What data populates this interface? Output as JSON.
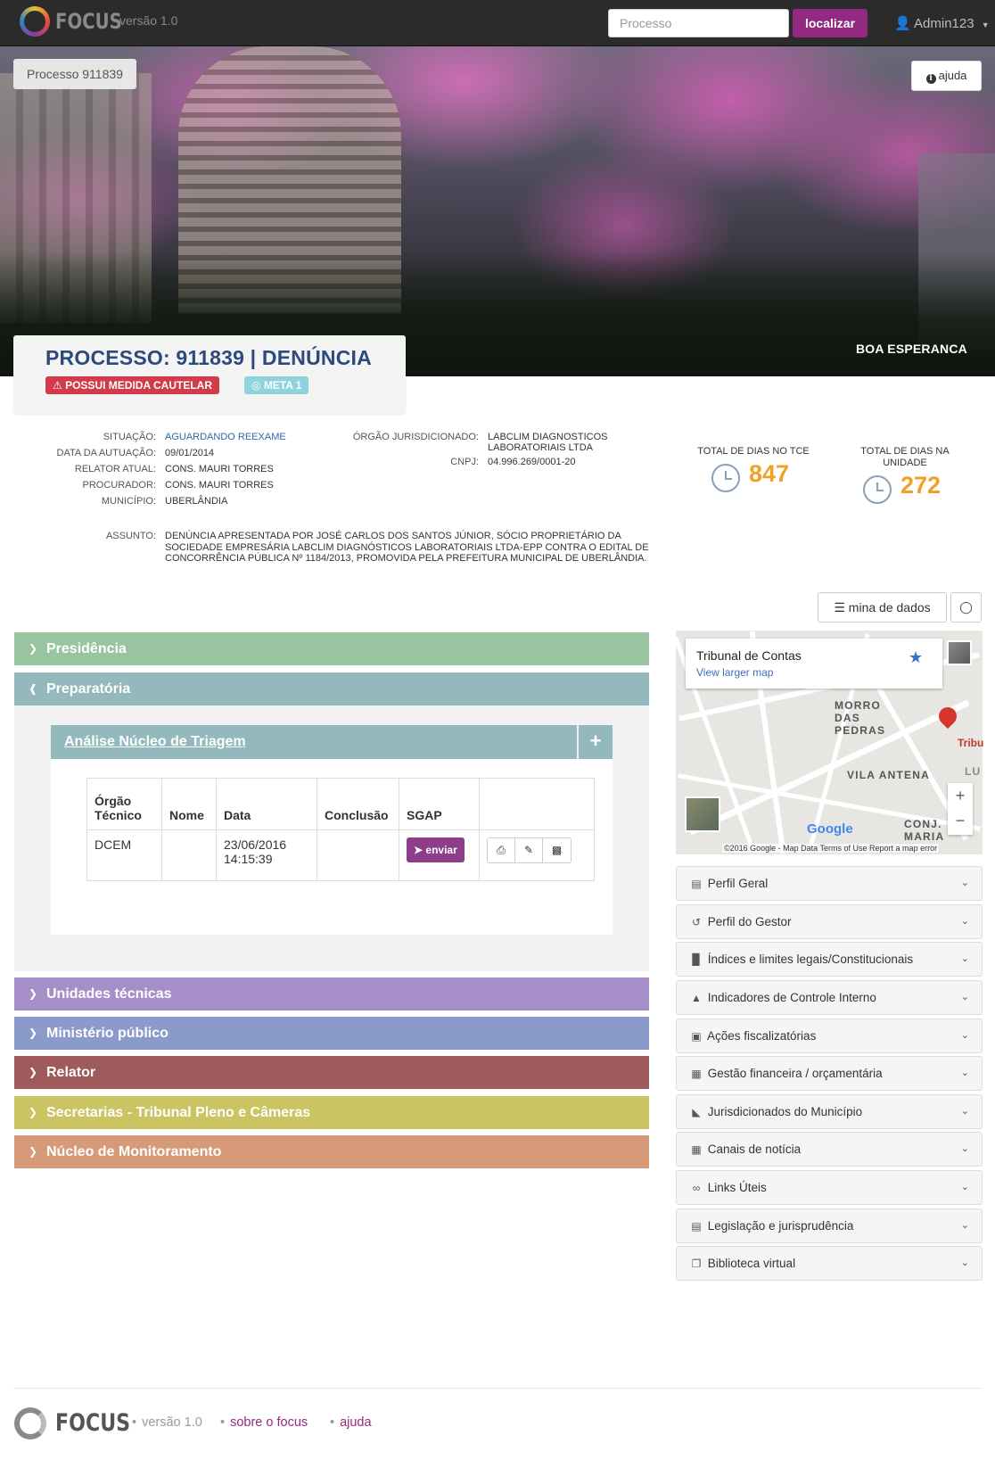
{
  "navbar": {
    "brand": "FOCUS",
    "version": "versão 1.0",
    "search_placeholder": "Processo",
    "search_button": "localizar",
    "user": "Admin123"
  },
  "hero": {
    "tag": "Processo 911839",
    "help": "ajuda",
    "city": "BOA ESPERANCA"
  },
  "title": {
    "heading": "PROCESSO: 911839 | DENÚNCIA",
    "badge_caution": "POSSUI MEDIDA CAUTELAR",
    "badge_meta": "META 1"
  },
  "info_left": [
    {
      "label": "SITUAÇÃO:",
      "value": "AGUARDANDO REEXAME"
    },
    {
      "label": "DATA DA AUTUAÇÃO:",
      "value": "09/01/2014"
    },
    {
      "label": "RELATOR ATUAL:",
      "value": "CONS. MAURI TORRES"
    },
    {
      "label": "PROCURADOR:",
      "value": "CONS. MAURI TORRES"
    },
    {
      "label": "MUNICÍPIO:",
      "value": "UBERLÂNDIA"
    }
  ],
  "info_right": [
    {
      "label": "ÓRGÃO JURISDICIONADO:",
      "value": "LABCLIM DIAGNOSTICOS LABORATORIAIS LTDA"
    },
    {
      "label": "CNPJ:",
      "value": "04.996.269/0001-20"
    }
  ],
  "subject": {
    "label": "ASSUNTO:",
    "text": "DENÚNCIA APRESENTADA POR JOSÉ CARLOS DOS SANTOS JÚNIOR, SÓCIO PROPRIETÁRIO DA SOCIEDADE EMPRESÁRIA LABCLIM DIAGNÓSTICOS LABORATORIAIS LTDA-EPP CONTRA O EDITAL DE CONCORRÊNCIA PÚBLICA Nº 1184/2013, PROMOVIDA PELA PREFEITURA MUNICIPAL DE UBERLÂNDIA."
  },
  "stats": {
    "tce_label": "TOTAL DE DIAS NO TCE",
    "tce_value": "847",
    "unit_label": "TOTAL DE DIAS NA UNIDADE",
    "unit_value": "272"
  },
  "toolbar": {
    "mine_label": "mina de dados"
  },
  "accordion": [
    {
      "label": "Presidência",
      "color": "#98c4a0",
      "open": false
    },
    {
      "label": "Preparatória",
      "color": "#94b9bc",
      "open": true
    },
    {
      "label": "Unidades técnicas",
      "color": "#a68fc9",
      "open": false
    },
    {
      "label": "Ministério público",
      "color": "#8a9bcb",
      "open": false
    },
    {
      "label": "Relator",
      "color": "#9f5b5b",
      "open": false
    },
    {
      "label": "Secretarias - Tribunal Pleno e Câmeras",
      "color": "#cac462",
      "open": false
    },
    {
      "label": "Núcleo de Monitoramento",
      "color": "#d79a78",
      "open": false
    }
  ],
  "sub_section": {
    "title": "Análise Núcleo de Triagem"
  },
  "table": {
    "headers": [
      "Órgão Técnico",
      "Nome",
      "Data",
      "Conclusão",
      "SGAP",
      ""
    ],
    "row": {
      "orgao": "DCEM",
      "nome": "",
      "data_date": "23/06/2016",
      "data_time": "14:15:39",
      "conclusao": "",
      "send_label": "enviar"
    }
  },
  "map": {
    "place": "Tribunal de Contas",
    "larger_link": "View larger map",
    "area1": "MORRO DAS PEDRAS",
    "area2": "VILA ANTENA",
    "area3": "CONJ. MARIA",
    "pin_label": "Tribu",
    "lu": "LU",
    "google": "Google",
    "footer": "©2016 Google - Map Data   Terms of Use   Report a map error"
  },
  "panels": [
    {
      "label": "Perfil Geral",
      "icon": "file-icon"
    },
    {
      "label": "Perfil do Gestor",
      "icon": "history-icon"
    },
    {
      "label": "Índices e limites legais/Constitucionais",
      "icon": "bar-chart-icon"
    },
    {
      "label": "Indicadores de Controle Interno",
      "icon": "area-chart-icon"
    },
    {
      "label": "Ações fiscalizatórias",
      "icon": "briefcase-icon"
    },
    {
      "label": "Gestão financeira / orçamentária",
      "icon": "calculator-icon"
    },
    {
      "label": "Jurisdicionados do Município",
      "icon": "industry-icon"
    },
    {
      "label": "Canais de notícia",
      "icon": "newspaper-icon"
    },
    {
      "label": "Links Úteis",
      "icon": "link-icon"
    },
    {
      "label": "Legislação e jurisprudência",
      "icon": "document-icon"
    },
    {
      "label": "Biblioteca virtual",
      "icon": "copy-icon"
    }
  ],
  "footer": {
    "brand": "FOCUS",
    "version": "versão 1.0",
    "about": "sobre o focus",
    "help": "ajuda"
  }
}
